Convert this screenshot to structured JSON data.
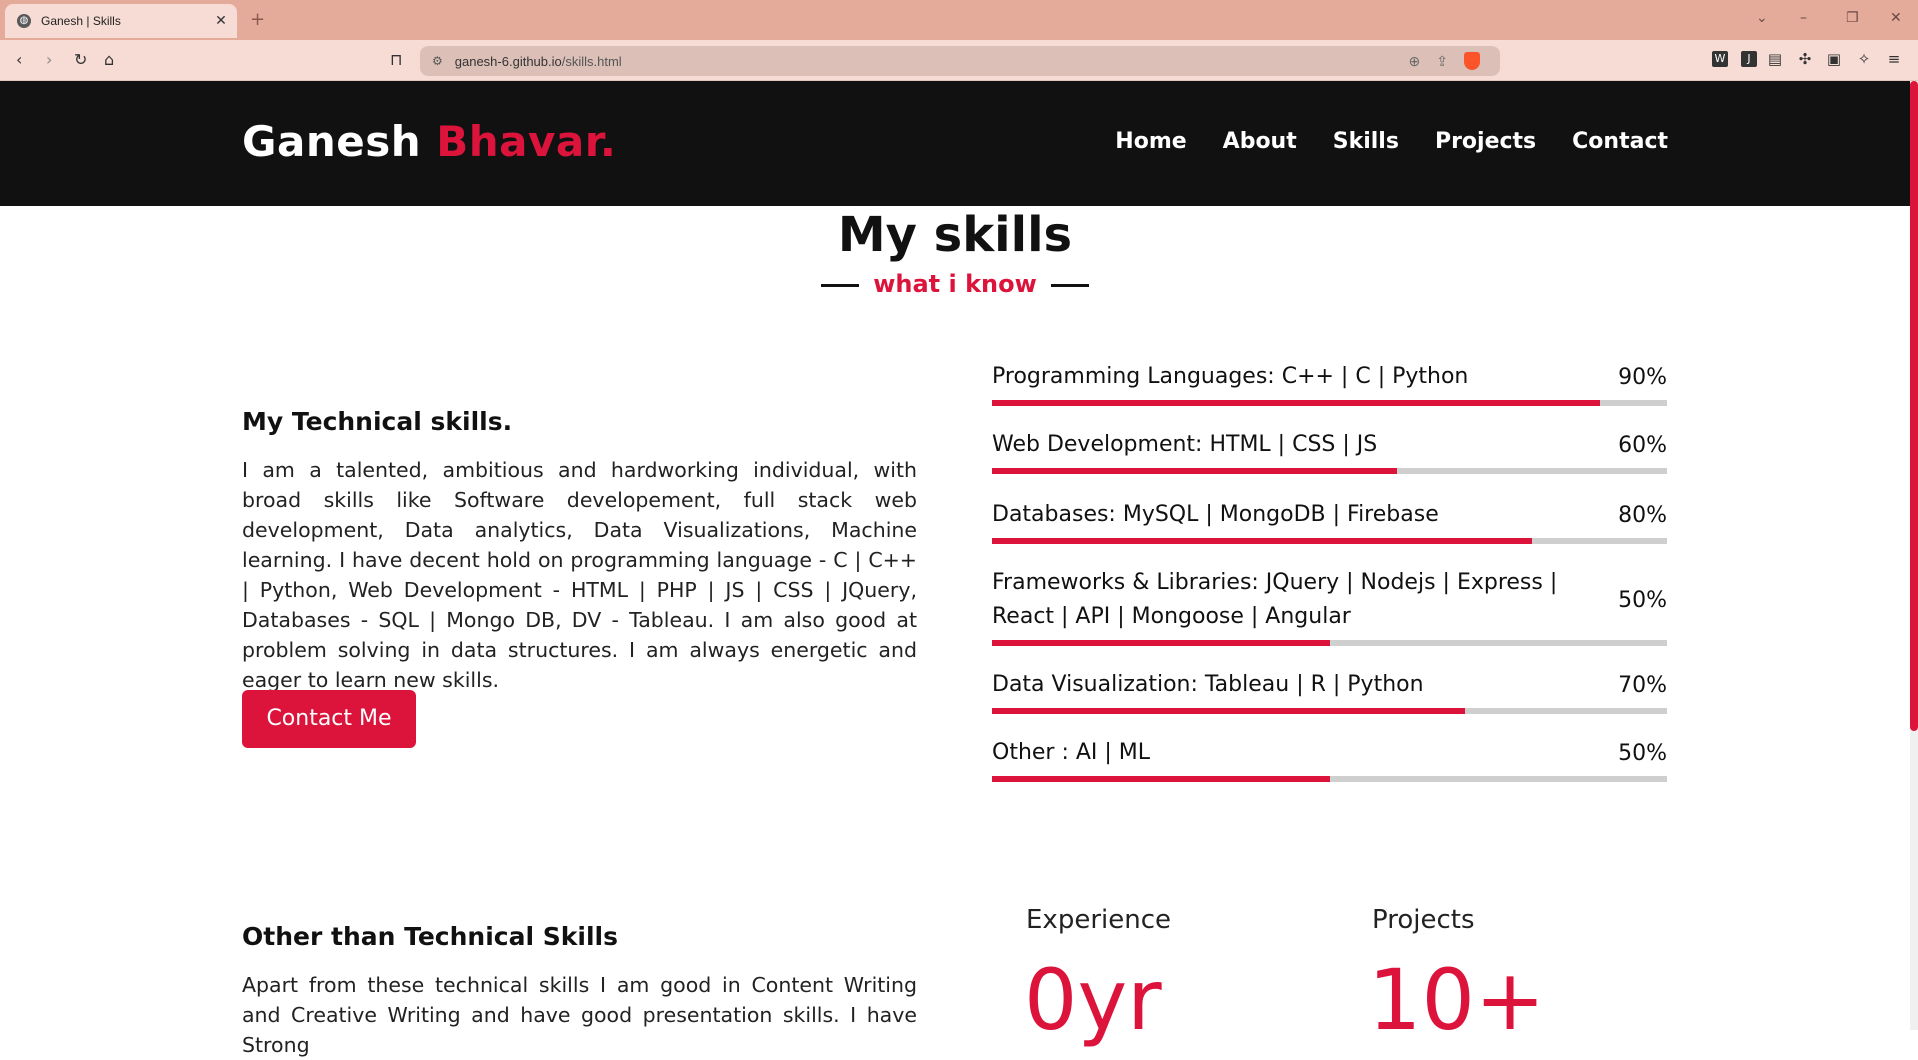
{
  "browser": {
    "tab_title": "Ganesh | Skills",
    "url_host": "ganesh-6.github.io",
    "url_path": "/skills.html"
  },
  "nav": {
    "logo_first": "Ganesh",
    "logo_last": "Bhavar.",
    "links": [
      "Home",
      "About",
      "Skills",
      "Projects",
      "Contact"
    ]
  },
  "section": {
    "title": "My skills",
    "subtitle": "what i know"
  },
  "technical": {
    "heading": "My Technical skills.",
    "text": "I am a talented, ambitious and hardworking individual, with broad skills like Software developement, full stack web development, Data analytics, Data Visualizations, Machine learning. I have decent hold on programming language - C | C++ | Python, Web Development - HTML | PHP | JS | CSS | JQuery, Databases - SQL | Mongo DB, DV - Tableau. I am also good at problem solving in data structures. I am always energetic and eager to learn new skills.",
    "button": "Contact Me"
  },
  "skills": [
    {
      "name": "Programming Languages: C++ | C | Python",
      "percent": "90%",
      "level": 0.9
    },
    {
      "name": "Web Development: HTML | CSS | JS",
      "percent": "60%",
      "level": 0.6
    },
    {
      "name": "Databases: MySQL | MongoDB | Firebase",
      "percent": "80%",
      "level": 0.8
    },
    {
      "name": "Frameworks & Libraries: JQuery | Nodejs | Express | React | API | Mongoose | Angular",
      "percent": "50%",
      "level": 0.5
    },
    {
      "name": "Data Visualization: Tableau | R | Python",
      "percent": "70%",
      "level": 0.7
    },
    {
      "name": "Other : AI | ML",
      "percent": "50%",
      "level": 0.5
    }
  ],
  "other": {
    "heading": "Other than Technical Skills",
    "text": "Apart from these technical skills I am good in Content Writing and Creative Writing and have good presentation skills. I have Strong"
  },
  "stats": [
    {
      "label": "Experience",
      "value": "0yr"
    },
    {
      "label": "Projects",
      "value": "10+"
    }
  ],
  "colors": {
    "accent": "#dc143c",
    "nav_bg": "#111111"
  }
}
